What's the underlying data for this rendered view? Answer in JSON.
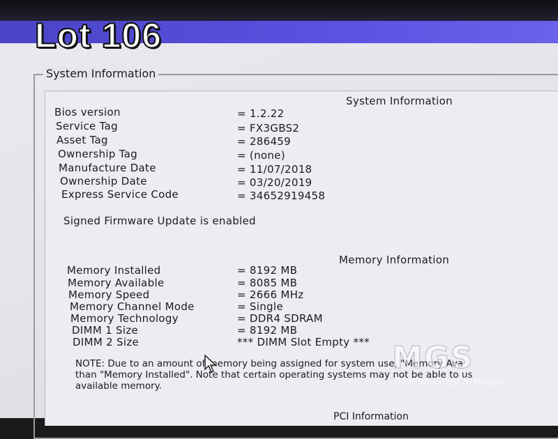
{
  "overlay": {
    "lot_label": "Lot 106"
  },
  "groupbox": {
    "title": "System Information"
  },
  "system_info": {
    "heading": "System Information",
    "rows": [
      {
        "label": "Bios version",
        "value": "= 1.2.22"
      },
      {
        "label": "Service Tag",
        "value": "= FX3GBS2"
      },
      {
        "label": "Asset Tag",
        "value": "= 286459"
      },
      {
        "label": "Ownership Tag",
        "value": "= (none)"
      },
      {
        "label": "Manufacture Date",
        "value": "= 11/07/2018"
      },
      {
        "label": "Ownership Date",
        "value": "= 03/20/2019"
      },
      {
        "label": "Express Service Code",
        "value": "= 34652919458"
      }
    ],
    "firmware_status": "Signed Firmware Update is enabled"
  },
  "memory_info": {
    "heading": "Memory Information",
    "rows": [
      {
        "label": "Memory Installed",
        "value": "= 8192 MB"
      },
      {
        "label": "Memory Available",
        "value": "= 8085 MB"
      },
      {
        "label": "Memory Speed",
        "value": "= 2666 MHz"
      },
      {
        "label": "Memory Channel Mode",
        "value": "= Single"
      },
      {
        "label": "Memory Technology",
        "value": "= DDR4 SDRAM"
      },
      {
        "label": "DIMM 1 Size",
        "value": "= 8192 MB"
      },
      {
        "label": "DIMM 2 Size",
        "value": "*** DIMM Slot Empty ***"
      }
    ],
    "note": "NOTE: Due to an amount of memory being assigned for system use, \"Memory Ava\nthan \"Memory Installed\". Note that certain operating systems may not be able to us\navailable memory."
  },
  "next_section_partial": "PCI Information",
  "watermark": {
    "logo": "MGS",
    "name": "Mason Gray Strange"
  },
  "colors": {
    "title_bar": "#5a52e0",
    "screen_bg": "#e6e6ec",
    "text": "#1a1a20"
  }
}
